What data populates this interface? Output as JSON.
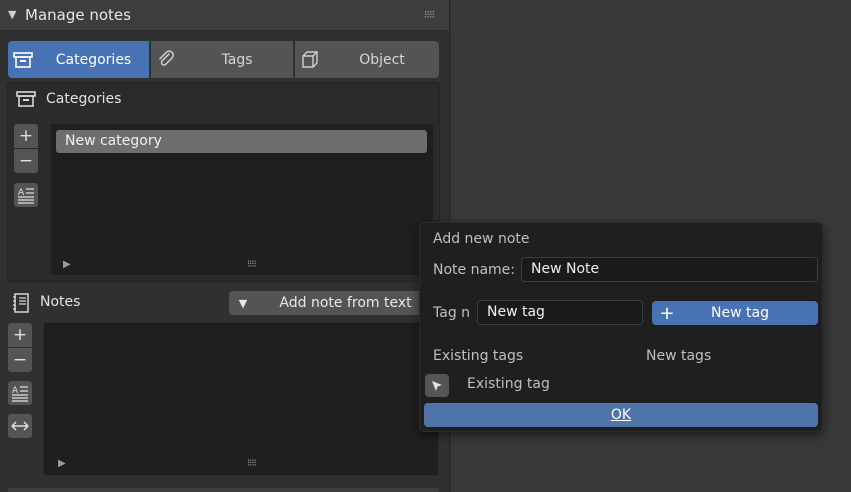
{
  "panel": {
    "title": "Manage notes",
    "tabs": [
      {
        "label": "Categories"
      },
      {
        "label": "Tags"
      },
      {
        "label": "Object"
      }
    ],
    "categories_section": {
      "title": "Categories",
      "items": [
        "New category"
      ]
    },
    "notes_section": {
      "title": "Notes",
      "dropdown_label": "Add note from text"
    }
  },
  "popup": {
    "title": "Add new note",
    "note_name_label": "Note name:",
    "note_name_value": "New Note",
    "tag_label": "Tag n",
    "tag_value": "New tag",
    "new_tag_button": "New tag",
    "existing_tags_label": "Existing tags",
    "new_tags_label": "New tags",
    "existing_tag_item": "Existing tag",
    "ok_label": "OK"
  },
  "colors": {
    "accent": "#4772b3",
    "background": "#303030",
    "popup_bg": "#1f1f1f",
    "list_bg": "#1f1f1f",
    "selected_item": "#6e6e6e"
  }
}
